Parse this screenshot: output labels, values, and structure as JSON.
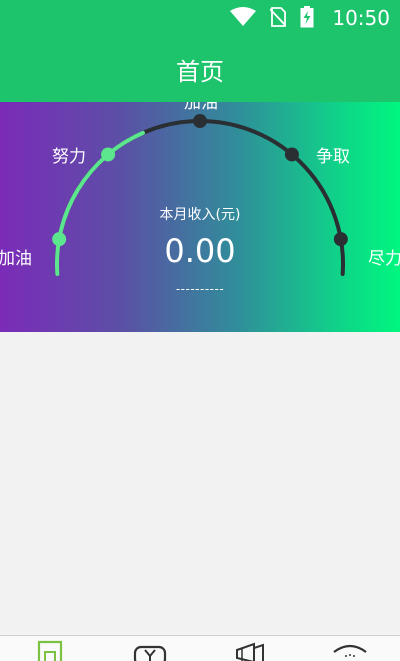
{
  "status_bar": {
    "time": "10:50",
    "icons": [
      "wifi-icon",
      "no-sim-icon",
      "battery-charging-icon"
    ]
  },
  "app_bar": {
    "title": "首页"
  },
  "gauge": {
    "levels": [
      "加油",
      "努力",
      "加油",
      "争取",
      "尽力"
    ],
    "progress_fraction": 0.375,
    "colors": {
      "filled": "#5ce68d",
      "track": "#2a2f33",
      "marker_filled": "#5ce68d",
      "marker_track": "#2a2f33"
    },
    "income_title": "本月收入(元)",
    "income_value": "0.00",
    "income_note": "----------"
  },
  "bottom_nav": {
    "items": [
      {
        "icon": "home-icon",
        "active": true
      },
      {
        "icon": "yuan-icon",
        "active": false
      },
      {
        "icon": "megaphone-icon",
        "active": false
      },
      {
        "icon": "profile-icon",
        "active": false
      }
    ],
    "active_color": "#7cc242"
  }
}
